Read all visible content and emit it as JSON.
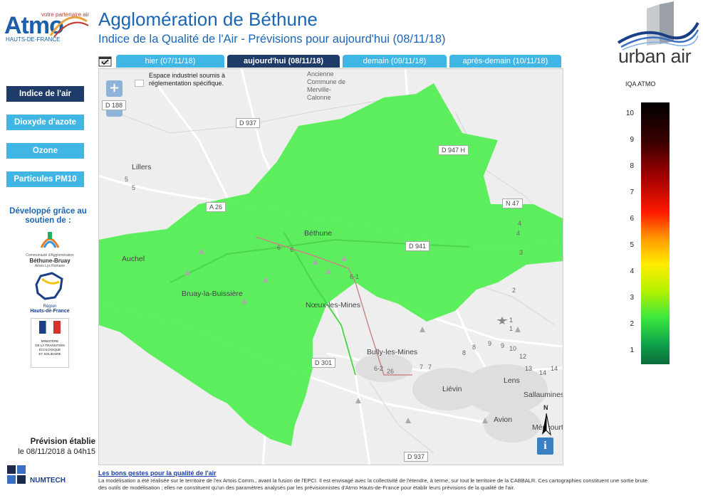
{
  "header": {
    "logo_small": "votre partenaire air",
    "logo_big": "Atmo",
    "logo_sub": "HAUTS-DE-FRANCE",
    "title": "Agglomération de Béthune",
    "subtitle": "Indice de la Qualité de l'Air - Prévisions pour aujourd'hui (08/11/18)",
    "urban_air": "urban air"
  },
  "tabs": [
    {
      "label": "hier (07/11/18)",
      "active": false
    },
    {
      "label": "aujourd'hui (08/11/18)",
      "active": true
    },
    {
      "label": "demain (09/11/18)",
      "active": false
    },
    {
      "label": "après-demain (10/11/18)",
      "active": false
    }
  ],
  "menu": [
    {
      "label": "Indice de l'air",
      "active": true
    },
    {
      "label": "Dioxyde d'azote",
      "active": false
    },
    {
      "label": "Ozone",
      "active": false
    },
    {
      "label": "Particules PM10",
      "active": false
    }
  ],
  "support": {
    "label": "Développé grâce au soutien de :",
    "sponsor1_lines": [
      "Communauté d'Agglomération",
      "Béthune-Bruay",
      "Artois Lys Romane"
    ],
    "sponsor2_lines": [
      "Région",
      "Hauts-de-France"
    ],
    "sponsor3_lines": [
      "MINISTÈRE",
      "DE LA TRANSITION",
      "ÉCOLOGIQUE",
      "ET SOLIDAIRE"
    ]
  },
  "forecast": {
    "label": "Prévision établie",
    "date": "le 08/11/2018 à 04h15"
  },
  "numtech": "NUMTECH",
  "map": {
    "zoom_in": "+",
    "zoom_out": "−",
    "legend_note_line1": "Espace industriel soumis à",
    "legend_note_line2": "réglementation spécifique.",
    "info": "i",
    "north": "N",
    "places": [
      "Lillers",
      "Auchel",
      "Béthune",
      "Bruay-la-Buissière",
      "Nœux-les-Mines",
      "Bully-les-Mines",
      "Liévin",
      "Lens",
      "Sallaumines",
      "Avion",
      "Méricourt"
    ],
    "roads": [
      "D 188",
      "D 937",
      "D 947 H",
      "N 47",
      "A 26",
      "D 941",
      "D 301",
      "D 937"
    ],
    "road_numbers": [
      "5",
      "5",
      "6",
      "6",
      "6-1",
      "4",
      "4",
      "3",
      "2",
      "1",
      "1",
      "8",
      "8",
      "9",
      "9",
      "10",
      "12",
      "13",
      "14",
      "14",
      "7",
      "7",
      "6-2",
      "26"
    ],
    "top_label": "Ancienne Commune de Merville-Calonne",
    "fill_color": "#50ee50"
  },
  "scale": {
    "title": "IQA ATMO",
    "labels": [
      "10",
      "9",
      "8",
      "7",
      "6",
      "5",
      "4",
      "3",
      "2",
      "1"
    ],
    "current_index": 3
  },
  "footer": {
    "link": "Les bons gestes pour la qualité de l'air",
    "line1": "La modélisation a été réalisée sur le territoire de l'ex Artois Comm., avant la fusion de l'EPCI. Il est envisagé avec la collectivité de l'étendre, à terme, sur tout le territoire de la CABBALR. Ces cartographies constituent une sortie brute",
    "line2": "des outils de modélisation ; elles ne constituent qu'un des paramètres analysés par les prévisionnistes d'Atmo Hauts-de-France pour établir leurs prévisions de la qualité de l'air."
  }
}
